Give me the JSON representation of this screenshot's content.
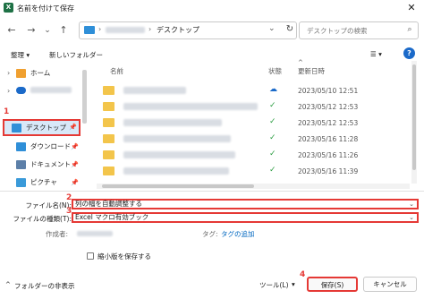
{
  "window": {
    "title": "名前を付けて保存",
    "app_icon": "excel-icon",
    "close": "✕"
  },
  "nav": {
    "back": "←",
    "forward": "→",
    "dropdown": "⌄",
    "up": "↑",
    "address_current": "デスクトップ",
    "address_sep1": "›",
    "address_sep2": "›",
    "address_drop": "⌄",
    "refresh": "↻",
    "search_placeholder": "デスクトップの検索",
    "search_icon": "⌕"
  },
  "toolbar": {
    "organize": "整理 ▾",
    "new_folder": "新しいフォルダー",
    "view": "☰ ▾",
    "help": "?"
  },
  "sidebar": {
    "items": [
      {
        "label": "ホーム",
        "icon": "home-icon"
      },
      {
        "label": "デスクトップ",
        "icon": "desktop-icon",
        "selected": true,
        "badge": "1"
      },
      {
        "label": "ダウンロード",
        "icon": "download-icon"
      },
      {
        "label": "ドキュメント",
        "icon": "document-icon"
      },
      {
        "label": "ピクチャ",
        "icon": "pictures-icon"
      }
    ],
    "collapse_arrow": "›",
    "expand_arrow_home": "›",
    "pin": "📌"
  },
  "file_list": {
    "headers": {
      "name": "名前",
      "status": "状態",
      "modified": "更新日時",
      "sort": "^"
    },
    "rows": [
      {
        "status": "☁",
        "modified": "2023/05/10 12:51"
      },
      {
        "status": "✓",
        "modified": "2023/05/12 12:53"
      },
      {
        "status": "✓",
        "modified": "2023/05/12 12:53"
      },
      {
        "status": "✓",
        "modified": "2023/05/16 11:28"
      },
      {
        "status": "✓",
        "modified": "2023/05/16 11:26"
      },
      {
        "status": "✓",
        "modified": "2023/05/16 11:39"
      }
    ]
  },
  "form": {
    "filename_label": "ファイル名(N):",
    "filename_value": "列の幅を自動調整する",
    "filename_badge": "2",
    "filetype_label": "ファイルの種類(T):",
    "filetype_value": "Excel マクロ有効ブック",
    "filetype_badge": "3",
    "author_label": "作成者:",
    "tag_label": "タグ:",
    "tag_link": "タグの追加",
    "thumbnail_label": "縮小版を保存する",
    "dropdown": "⌄"
  },
  "footer": {
    "hide_folders": "フォルダーの非表示",
    "hide_arrow": "^",
    "tools": "ツール(L)",
    "tools_arrow": "▾",
    "save": "保存(S)",
    "save_badge": "4",
    "cancel": "キャンセル"
  },
  "colors": {
    "accent": "#e53935",
    "folder": "#f3c54b",
    "selection": "#d8e8f8",
    "excel": "#1e7145"
  }
}
